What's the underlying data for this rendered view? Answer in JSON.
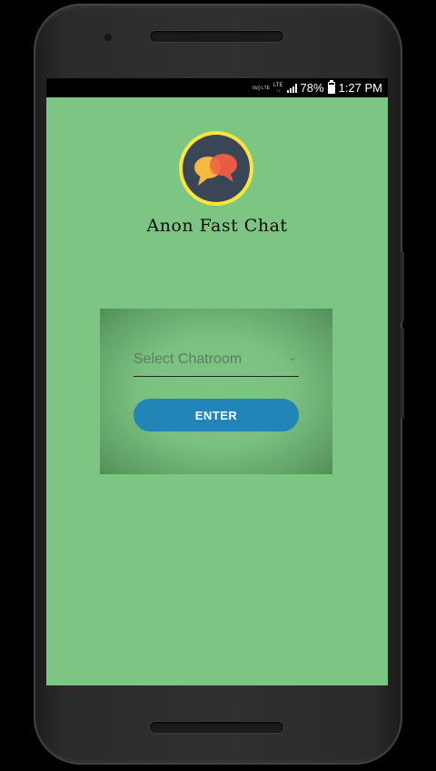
{
  "status_bar": {
    "network_top": "Vo)) LTE",
    "network_mid": "LTE",
    "battery": "78%",
    "battery_level": 0.78,
    "time": "1:27 PM"
  },
  "app": {
    "background_color": "#7dc583",
    "logo_icon": "chat-bubbles-icon",
    "title": "Anon Fast Chat"
  },
  "chatroom_select": {
    "placeholder": "Select Chatroom",
    "caret_icon": "chevron-down-icon"
  },
  "enter_button": {
    "label": "ENTER",
    "color": "#2384b8"
  }
}
